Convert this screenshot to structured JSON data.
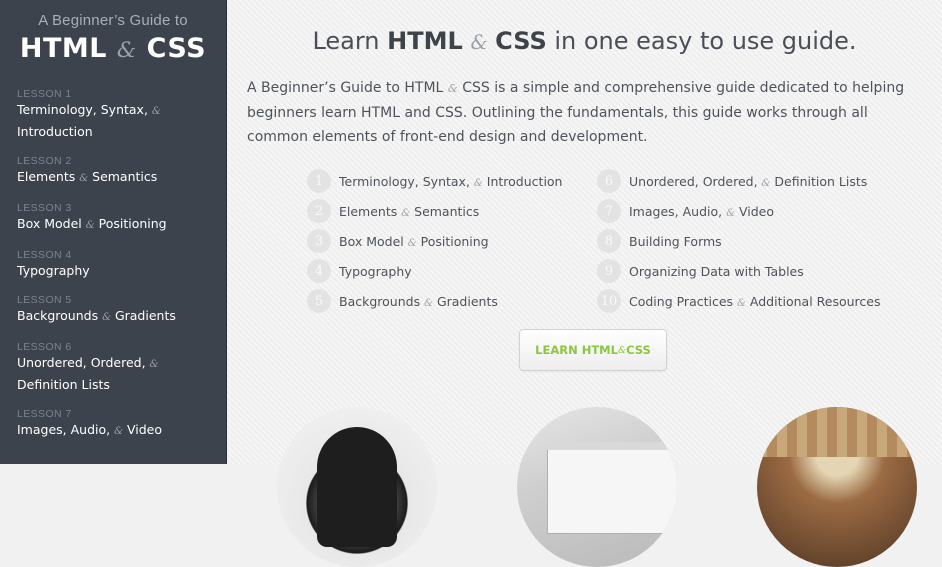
{
  "sidebar": {
    "brand_sub": "A Beginner’s Guide to",
    "brand_html": "HTML",
    "brand_amp": "&",
    "brand_css": "CSS",
    "lessons": [
      {
        "num": "Lesson 1",
        "title": "Terminology, Syntax, & Introduction"
      },
      {
        "num": "Lesson 2",
        "title": "Elements & Semantics"
      },
      {
        "num": "Lesson 3",
        "title": "Box Model & Positioning"
      },
      {
        "num": "Lesson 4",
        "title": "Typography"
      },
      {
        "num": "Lesson 5",
        "title": "Backgrounds & Gradients"
      },
      {
        "num": "Lesson 6",
        "title": "Unordered, Ordered, & Definition Lists"
      },
      {
        "num": "Lesson 7",
        "title": "Images, Audio, & Video"
      }
    ]
  },
  "main": {
    "headline_pre": "Learn ",
    "headline_html": "HTML",
    "headline_amp": "&",
    "headline_css": "CSS",
    "headline_post": " in one easy to use guide.",
    "intro": "A Beginner’s Guide to HTML & CSS is a simple and comprehensive guide dedicated to helping beginners learn HTML and CSS. Outlining the fundamentals, this guide works through all common elements of front-end design and development.",
    "toc_left": [
      {
        "n": "1",
        "label": "Terminology, Syntax, & Introduction"
      },
      {
        "n": "2",
        "label": "Elements & Semantics"
      },
      {
        "n": "3",
        "label": "Box Model & Positioning"
      },
      {
        "n": "4",
        "label": "Typography"
      },
      {
        "n": "5",
        "label": "Backgrounds & Gradients"
      }
    ],
    "toc_right": [
      {
        "n": "6",
        "label": "Unordered, Ordered, & Definition Lists"
      },
      {
        "n": "7",
        "label": "Images, Audio, & Video"
      },
      {
        "n": "8",
        "label": "Building Forms"
      },
      {
        "n": "9",
        "label": "Organizing Data with Tables"
      },
      {
        "n": "10",
        "label": "Coding Practices & Additional Resources"
      }
    ],
    "cta_pre": "LEARN HTML ",
    "cta_amp": "&",
    "cta_post": " CSS"
  },
  "colors": {
    "sidebar_bg": "#3d434d",
    "accent_green": "#8cc63f",
    "page_bg": "#f2f2f2"
  }
}
